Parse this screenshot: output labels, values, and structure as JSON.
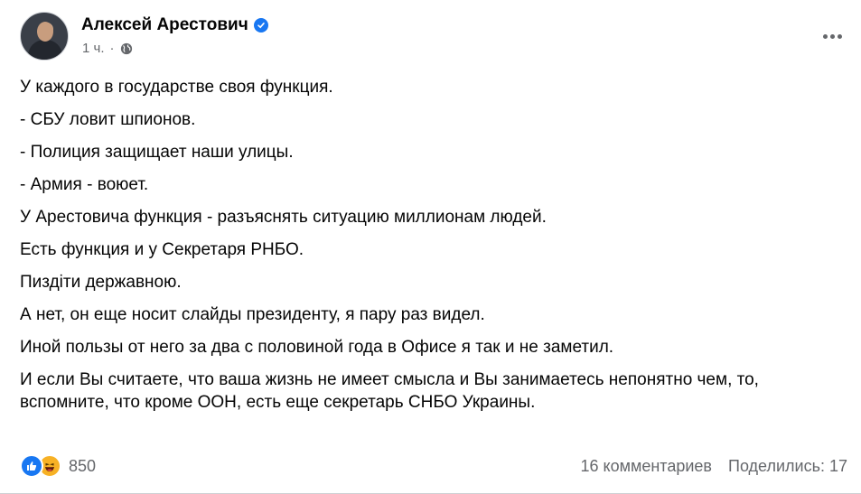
{
  "post": {
    "author": "Алексей Арестович",
    "time": "1 ч.",
    "separator": "·",
    "verified_icon": "verified-badge-icon",
    "privacy_icon": "globe-icon",
    "paragraphs": [
      "У каждого в государстве своя функция.",
      "- СБУ ловит шпионов.",
      "- Полиция защищает наши улицы.",
      "- Армия - воюет.",
      "У Арестовича функция - разъяснять ситуацию  миллионам людей.",
      "Есть функция и у Секретаря РНБО.",
      "Пиздіти державною.",
      "А нет, он еще носит слайды президенту, я пару раз видел.",
      "Иной пользы от него за два с половиной года в Офисе я так и не заметил.",
      "И если Вы считаете, что ваша жизнь не имеет смысла и Вы занимаетесь непонятно чем, то, вспомните, что кроме ООН, есть еще секретарь СНБО Украины."
    ]
  },
  "footer": {
    "reaction_count": "850",
    "comments": "16 комментариев",
    "shares": "Поделились: 17"
  },
  "colors": {
    "accent": "#1877f2",
    "secondary_text": "#65676b",
    "haha": "#f7b125"
  }
}
